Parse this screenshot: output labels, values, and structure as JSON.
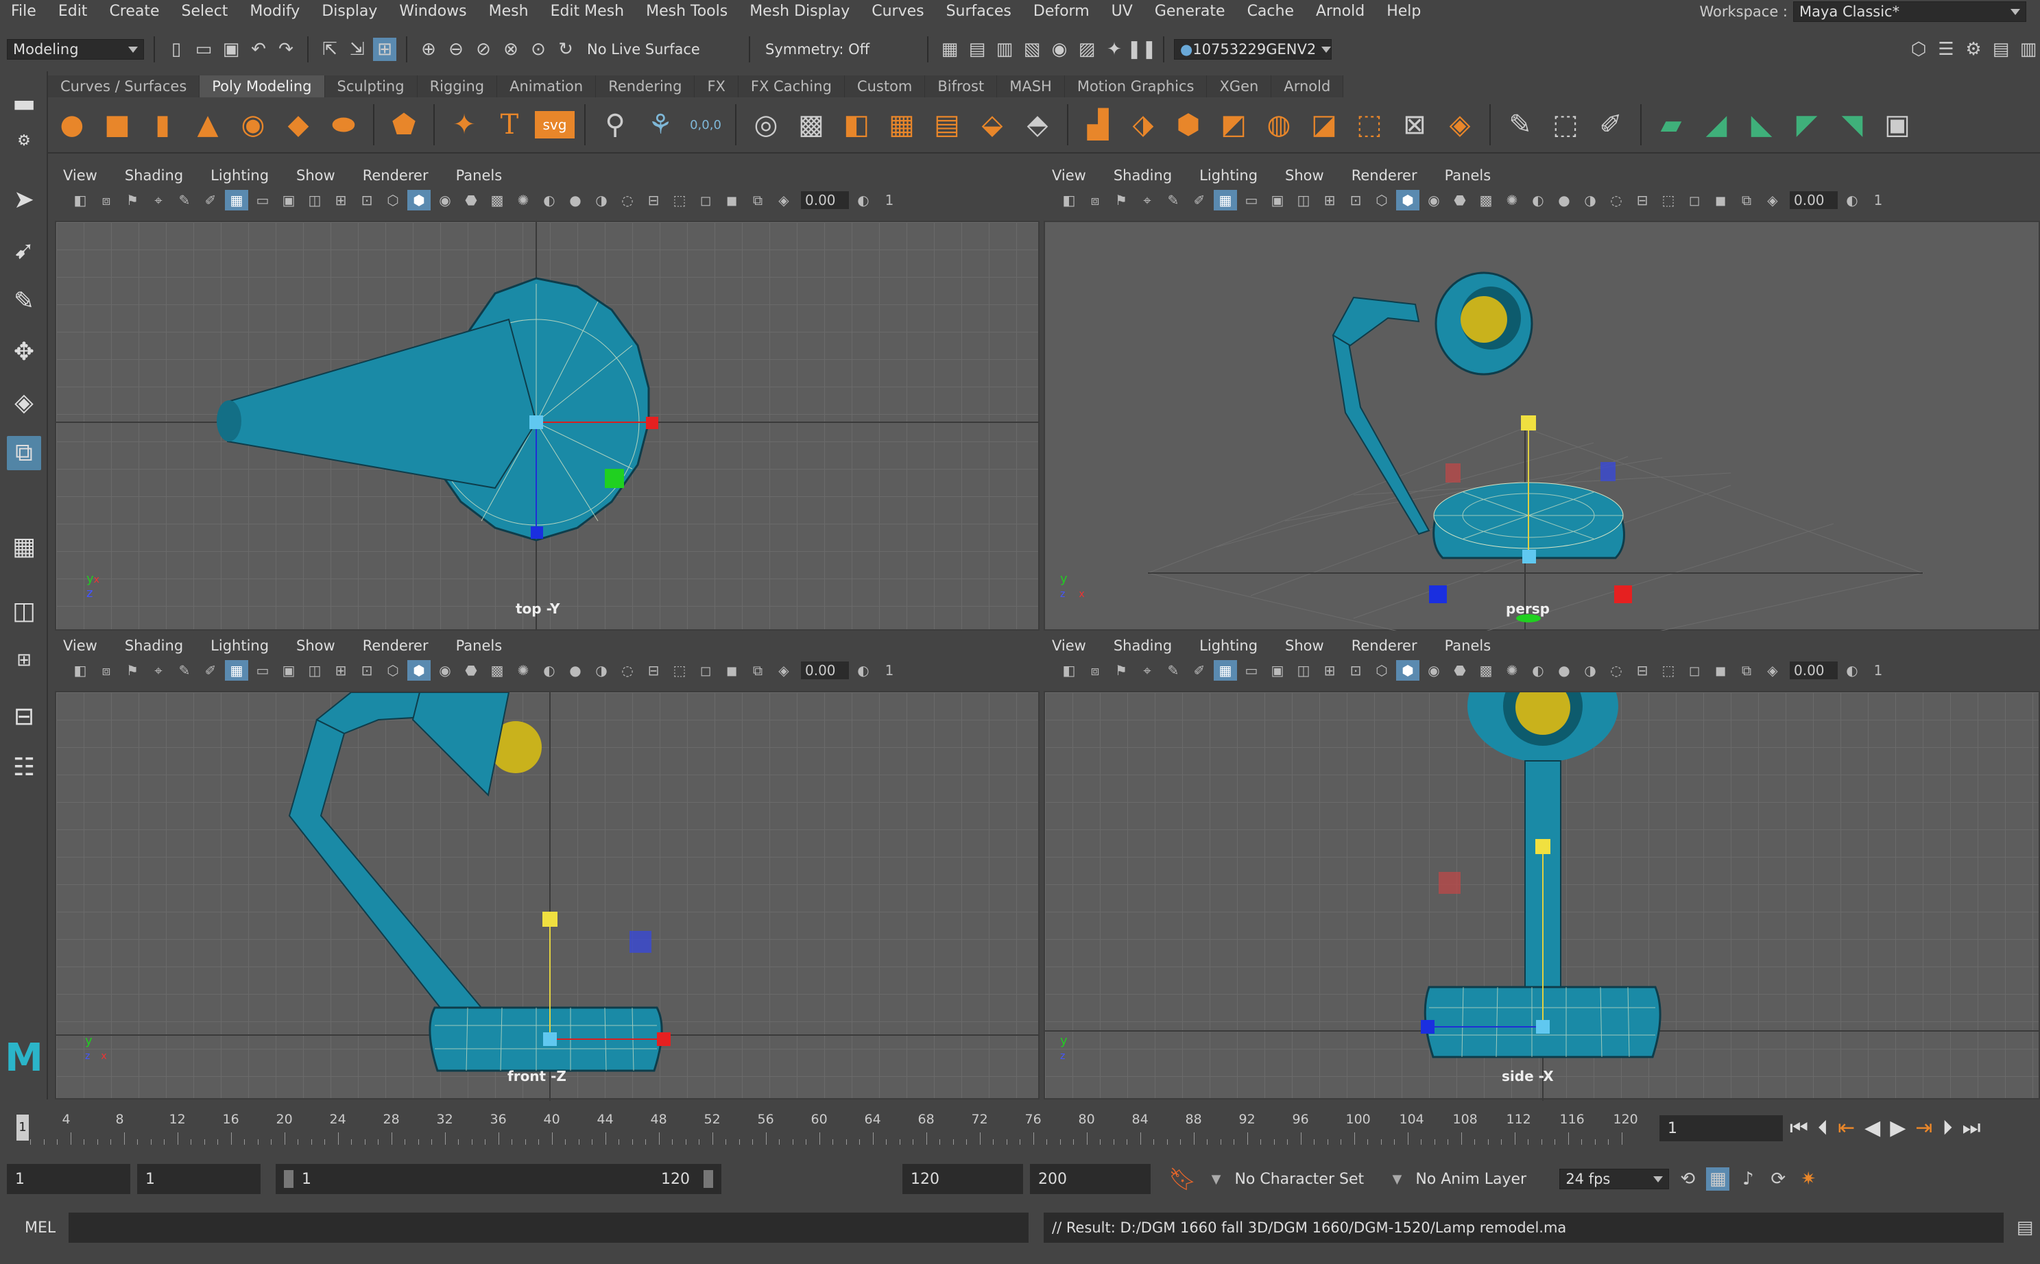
{
  "menubar": {
    "items": [
      "File",
      "Edit",
      "Create",
      "Select",
      "Modify",
      "Display",
      "Windows",
      "Mesh",
      "Edit Mesh",
      "Mesh Tools",
      "Mesh Display",
      "Curves",
      "Surfaces",
      "Deform",
      "UV",
      "Generate",
      "Cache",
      "Arnold",
      "Help"
    ],
    "workspace_label": "Workspace :",
    "workspace_value": "Maya Classic*"
  },
  "statusline": {
    "mode": "Modeling",
    "live_surface": "No Live Surface",
    "symmetry": "Symmetry: Off",
    "user": "10753229GENV2"
  },
  "shelf": {
    "tabs": [
      "Curves / Surfaces",
      "Poly Modeling",
      "Sculpting",
      "Rigging",
      "Animation",
      "Rendering",
      "FX",
      "FX Caching",
      "Custom",
      "Bifrost",
      "MASH",
      "Motion Graphics",
      "XGen",
      "Arnold"
    ],
    "active_tab": "Poly Modeling",
    "svg_label": "svg",
    "t_label": "T",
    "origin_label": "0,0,0"
  },
  "panel_menu": [
    "View",
    "Shading",
    "Lighting",
    "Show",
    "Renderer",
    "Panels"
  ],
  "panel_value": "0.00",
  "panel_one": "1",
  "viewports": {
    "top": {
      "label": "top -Y",
      "axis_a": "y",
      "axis_b": "x",
      "axis_c": "z"
    },
    "persp": {
      "label": "persp",
      "axis_a": "y",
      "axis_b": "x",
      "axis_c": "z"
    },
    "front": {
      "label": "front -Z",
      "axis_a": "y",
      "axis_b": "x",
      "axis_c": "z"
    },
    "side": {
      "label": "side -X",
      "axis_a": "y",
      "axis_b": "z",
      "axis_c": ""
    }
  },
  "timeline": {
    "ticks": [
      "4",
      "8",
      "12",
      "16",
      "20",
      "24",
      "28",
      "32",
      "36",
      "40",
      "44",
      "48",
      "52",
      "56",
      "60",
      "64",
      "68",
      "72",
      "76",
      "80",
      "84",
      "88",
      "92",
      "96",
      "100",
      "104",
      "108",
      "112",
      "116",
      "120"
    ],
    "start_marker": "1",
    "current_frame": "1"
  },
  "range": {
    "start": "1",
    "anim_start": "1",
    "slider_start": "1",
    "slider_end": "120",
    "anim_end": "120",
    "end": "200",
    "character_set": "No Character Set",
    "anim_layer": "No Anim Layer",
    "fps": "24 fps"
  },
  "commandline": {
    "lang": "MEL",
    "result": "// Result: D:/DGM 1660 fall 3D/DGM 1660/DGM-1520/Lamp remodel.ma"
  },
  "colors": {
    "accent": "#5285a6",
    "mesh": "#1a8aa6",
    "bulb": "#c9b21c"
  }
}
